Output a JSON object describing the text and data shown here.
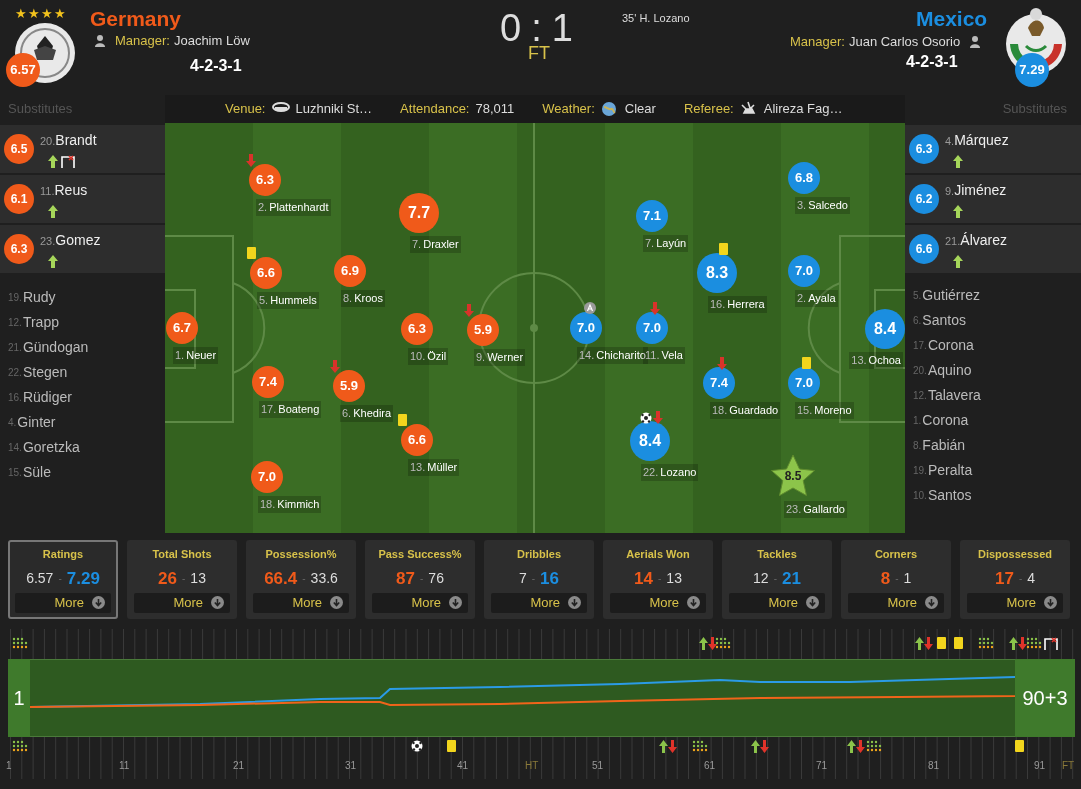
{
  "home": {
    "titles": "★★★★",
    "name": "Germany",
    "manager_label": "Manager:",
    "manager": "Joachim Löw",
    "formation": "4-2-3-1",
    "rating": "6.57"
  },
  "score": {
    "home": "0",
    "separator": ":",
    "away": "1",
    "status": "FT",
    "scorer": "35' H. Lozano"
  },
  "away": {
    "name": "Mexico",
    "manager_label": "Manager:",
    "manager": "Juan Carlos Osorio",
    "formation": "4-2-3-1",
    "rating": "7.29"
  },
  "substitutes_label": [
    "Substitutes",
    "Substitutes"
  ],
  "match_info": [
    {
      "kind": "venue",
      "label": "Venue:",
      "value": "Luzhniki St…"
    },
    {
      "kind": "attendance",
      "label": "Attendance:",
      "value": "78,011"
    },
    {
      "kind": "weather",
      "label": "Weather:",
      "value": "Clear"
    },
    {
      "kind": "referee",
      "label": "Referee:",
      "value": "Alireza Fag…"
    }
  ],
  "home_players": [
    {
      "number": "1.",
      "name": "Neuer",
      "rating": "6.7"
    },
    {
      "number": "2.",
      "name": "Plattenhardt",
      "rating": "6.3",
      "sub_off": true
    },
    {
      "number": "7.",
      "name": "Draxler",
      "rating": "7.7"
    },
    {
      "number": "5.",
      "name": "Hummels",
      "rating": "6.6",
      "yellow_card": true
    },
    {
      "number": "8.",
      "name": "Kroos",
      "rating": "6.9"
    },
    {
      "number": "10.",
      "name": "Özil",
      "rating": "6.3"
    },
    {
      "number": "9.",
      "name": "Werner",
      "rating": "5.9",
      "sub_off": true
    },
    {
      "number": "17.",
      "name": "Boateng",
      "rating": "7.4"
    },
    {
      "number": "6.",
      "name": "Khedira",
      "rating": "5.9",
      "sub_off": true
    },
    {
      "number": "13.",
      "name": "Müller",
      "rating": "6.6",
      "yellow_card": true
    },
    {
      "number": "18.",
      "name": "Kimmich",
      "rating": "7.0"
    }
  ],
  "away_players": [
    {
      "number": "14.",
      "name": "Chicharito",
      "rating": "7.0",
      "captain": true
    },
    {
      "number": "7.",
      "name": "Layún",
      "rating": "7.1"
    },
    {
      "number": "11.",
      "name": "Vela",
      "rating": "7.0",
      "sub_off": true
    },
    {
      "number": "16.",
      "name": "Herrera",
      "rating": "8.3",
      "yellow_card": true
    },
    {
      "number": "3.",
      "name": "Salcedo",
      "rating": "6.8"
    },
    {
      "number": "2.",
      "name": "Ayala",
      "rating": "7.0"
    },
    {
      "number": "18.",
      "name": "Guardado",
      "rating": "7.4",
      "sub_off": true
    },
    {
      "number": "15.",
      "name": "Moreno",
      "rating": "7.0",
      "yellow_card": true
    },
    {
      "number": "22.",
      "name": "Lozano",
      "rating": "8.4",
      "goal": true,
      "sub_off": true
    },
    {
      "number": "13.",
      "name": "Ochoa",
      "rating": "8.4"
    },
    {
      "number": "23.",
      "name": "Gallardo",
      "rating": "8.5",
      "man_of_the_match": true
    }
  ],
  "home_subs": [
    {
      "number": "20.",
      "name": "Brandt",
      "rating": "6.5",
      "sub_on": true,
      "woodwork": true
    },
    {
      "number": "11.",
      "name": "Reus",
      "rating": "6.1",
      "sub_on": true
    },
    {
      "number": "23.",
      "name": "Gomez",
      "rating": "6.3",
      "sub_on": true
    },
    {
      "number": "19.",
      "name": "Rudy"
    },
    {
      "number": "12.",
      "name": "Trapp"
    },
    {
      "number": "21.",
      "name": "Gündogan"
    },
    {
      "number": "22.",
      "name": "Stegen"
    },
    {
      "number": "16.",
      "name": "Rüdiger"
    },
    {
      "number": "4.",
      "name": "Ginter"
    },
    {
      "number": "14.",
      "name": "Goretzka"
    },
    {
      "number": "15.",
      "name": "Süle"
    }
  ],
  "away_subs": [
    {
      "number": "4.",
      "name": "Márquez",
      "rating": "6.3",
      "sub_on": true
    },
    {
      "number": "9.",
      "name": "Jiménez",
      "rating": "6.2",
      "sub_on": true
    },
    {
      "number": "21.",
      "name": "Álvarez",
      "rating": "6.6",
      "sub_on": true
    },
    {
      "number": "5.",
      "name": "Gutiérrez"
    },
    {
      "number": "6.",
      "name": "Santos"
    },
    {
      "number": "17.",
      "name": "Corona"
    },
    {
      "number": "20.",
      "name": "Aquino"
    },
    {
      "number": "12.",
      "name": "Talavera"
    },
    {
      "number": "1.",
      "name": "Corona"
    },
    {
      "number": "8.",
      "name": "Fabián"
    },
    {
      "number": "19.",
      "name": "Peralta"
    },
    {
      "number": "10.",
      "name": "Santos"
    }
  ],
  "stats": [
    {
      "label": "Ratings",
      "home": "6.57",
      "separator": "-",
      "away": "7.29",
      "home_leads": false,
      "more": "More",
      "selected": true
    },
    {
      "label": "Total Shots",
      "home": "26",
      "separator": "-",
      "away": "13",
      "home_leads": true,
      "more": "More",
      "selected": false
    },
    {
      "label": "Possession%",
      "home": "66.4",
      "separator": "-",
      "away": "33.6",
      "home_leads": true,
      "more": "More",
      "selected": false
    },
    {
      "label": "Pass Success%",
      "home": "87",
      "separator": "-",
      "away": "76",
      "home_leads": true,
      "more": "More",
      "selected": false
    },
    {
      "label": "Dribbles",
      "home": "7",
      "separator": "-",
      "away": "16",
      "home_leads": false,
      "more": "More",
      "selected": false
    },
    {
      "label": "Aerials Won",
      "home": "14",
      "separator": "-",
      "away": "13",
      "home_leads": true,
      "more": "More",
      "selected": false
    },
    {
      "label": "Tackles",
      "home": "12",
      "separator": "-",
      "away": "21",
      "home_leads": false,
      "more": "More",
      "selected": false
    },
    {
      "label": "Corners",
      "home": "8",
      "separator": "-",
      "away": "1",
      "home_leads": true,
      "more": "More",
      "selected": false
    },
    {
      "label": "Dispossessed",
      "home": "17",
      "separator": "-",
      "away": "4",
      "home_leads": true,
      "more": "More",
      "selected": false
    }
  ],
  "timeline": {
    "start": "1",
    "end": "90+3",
    "home_events": [
      {
        "kind": "formation"
      },
      {
        "kind": "substitution"
      },
      {
        "kind": "formation"
      },
      {
        "kind": "substitution"
      },
      {
        "kind": "yellow_card"
      },
      {
        "kind": "yellow_card"
      },
      {
        "kind": "formation"
      },
      {
        "kind": "substitution"
      },
      {
        "kind": "formation"
      },
      {
        "kind": "woodwork"
      }
    ],
    "away_events": [
      {
        "kind": "formation"
      },
      {
        "kind": "goal"
      },
      {
        "kind": "yellow_card"
      },
      {
        "kind": "substitution"
      },
      {
        "kind": "formation"
      },
      {
        "kind": "substitution"
      },
      {
        "kind": "substitution"
      },
      {
        "kind": "formation"
      },
      {
        "kind": "yellow_card"
      }
    ],
    "axis_labels": [
      "1",
      "11",
      "21",
      "31",
      "41",
      "HT",
      "51",
      "61",
      "71",
      "81",
      "91",
      "FT"
    ]
  }
}
